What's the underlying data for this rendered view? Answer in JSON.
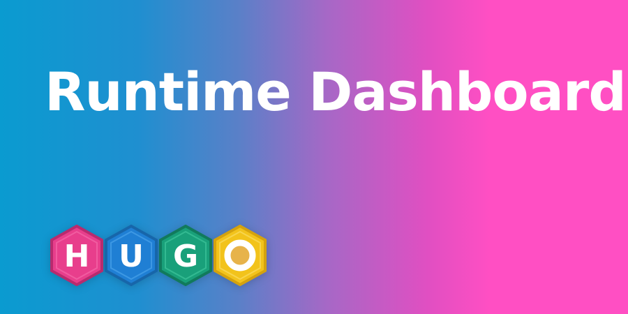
{
  "page": {
    "title": "Runtime Dashboard"
  },
  "logo": {
    "letters": [
      {
        "char": "H",
        "color": "#e83e8c"
      },
      {
        "char": "U",
        "color": "#1f7fd4"
      },
      {
        "char": "G",
        "color": "#19a07a"
      },
      {
        "char": "O",
        "color": "#f2c31b"
      }
    ],
    "brand_colors": {
      "pink": "#e83e8c",
      "blue": "#1f7fd4",
      "green": "#19a07a",
      "yellow": "#f2c31b"
    }
  }
}
